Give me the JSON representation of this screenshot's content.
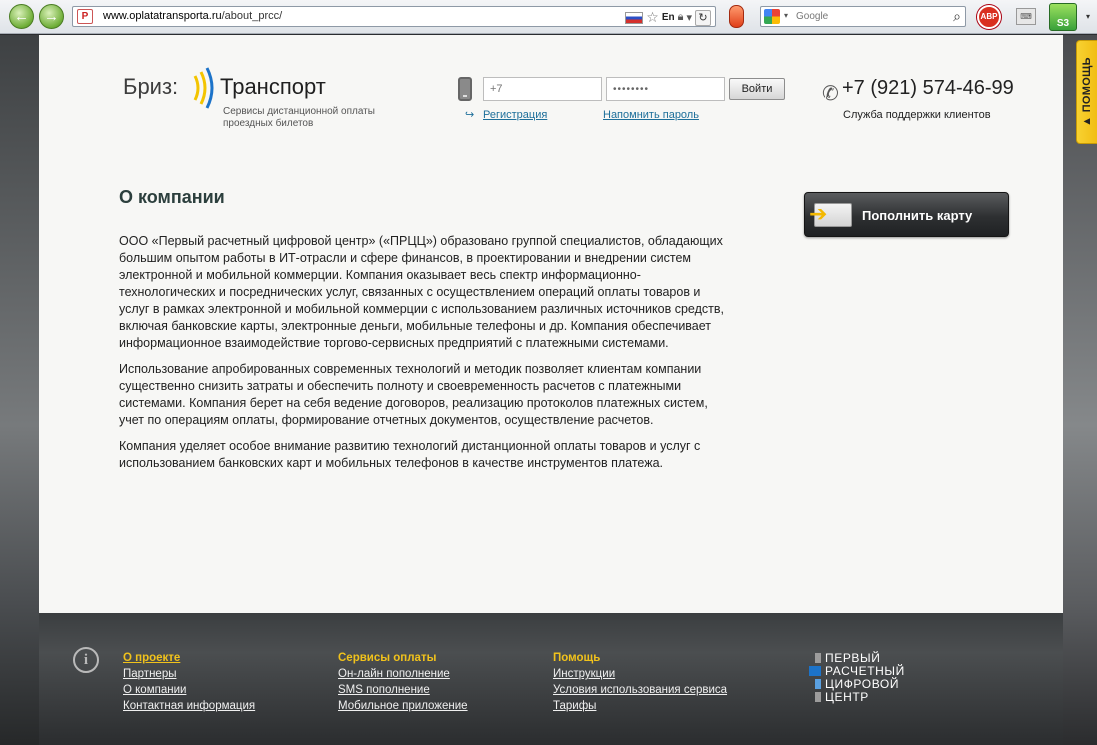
{
  "browser": {
    "url_host": "www.oplatatransporta.ru",
    "url_path": "/about_prcc/",
    "site_icon": "P",
    "lang_label": "En",
    "search_placeholder": "Google",
    "abp_label": "ABP",
    "s3_label": "S3"
  },
  "help_tab": {
    "label": "ПОМОЩЬ"
  },
  "logo": {
    "name_left": "Бриз:",
    "name_right": "Транспорт",
    "tagline_line1": "Сервисы дистанционной оплаты",
    "tagline_line2": "проездных билетов"
  },
  "login": {
    "phone_placeholder": "+7",
    "password_value": "••••••••",
    "login_button": "Войти",
    "register_arrow": "↪",
    "register_link": "Регистрация",
    "remind_link": "Напомнить пароль"
  },
  "support": {
    "phone": "+7 (921) 574-46-99",
    "caption": "Служба поддержки клиентов"
  },
  "main": {
    "title": "О компании",
    "paragraphs": [
      "ООО «Первый расчетный цифровой центр» («ПРЦЦ») образовано группой специалистов, обладающих большим опытом работы в ИТ-отрасли и сфере финансов, в проектировании и внедрении систем электронной и мобильной коммерции. Компания оказывает весь спектр информационно-технологических и посреднических услуг, связанных с осуществлением операций оплаты товаров и услуг в рамках электронной и мобильной коммерции с использованием различных источников средств, включая банковские карты, электронные деньги, мобильные телефоны и др. Компания обеспечивает информационное взаимодействие торгово-сервисных предприятий с платежными системами.",
      "Использование апробированных современных технологий и методик позволяет клиентам компании существенно снизить затраты и обеспечить полноту и своевременность расчетов с платежными системами. Компания берет на себя ведение договоров, реализацию протоколов платежных систем, учет по операциям оплаты, формирование отчетных документов, осуществление расчетов.",
      "Компания уделяет особое внимание развитию технологий дистанционной оплаты товаров и услуг с использованием банковских карт и мобильных телефонов в качестве инструментов платежа."
    ],
    "topup_button": "Пополнить карту"
  },
  "footer": {
    "columns": [
      {
        "heading": "О проекте",
        "links": [
          "Партнеры",
          "О компании",
          "Контактная информация"
        ]
      },
      {
        "heading": "Сервисы оплаты",
        "links": [
          "Он-лайн пополнение",
          "SMS пополнение",
          "Мобильное приложение"
        ]
      },
      {
        "heading": "Помощь",
        "links": [
          "Инструкции",
          "Условия использования сервиса",
          "Тарифы"
        ]
      }
    ],
    "logo_lines": [
      "ПЕРВЫЙ",
      "РАСЧЕТНЫЙ",
      "ЦИФРОВОЙ",
      "ЦЕНТР"
    ]
  },
  "colors": {
    "accent_yellow": "#f1c21b",
    "link_blue": "#1e6f9a",
    "logo_yellow": "#f3c400",
    "logo_blue": "#1c73c9"
  }
}
